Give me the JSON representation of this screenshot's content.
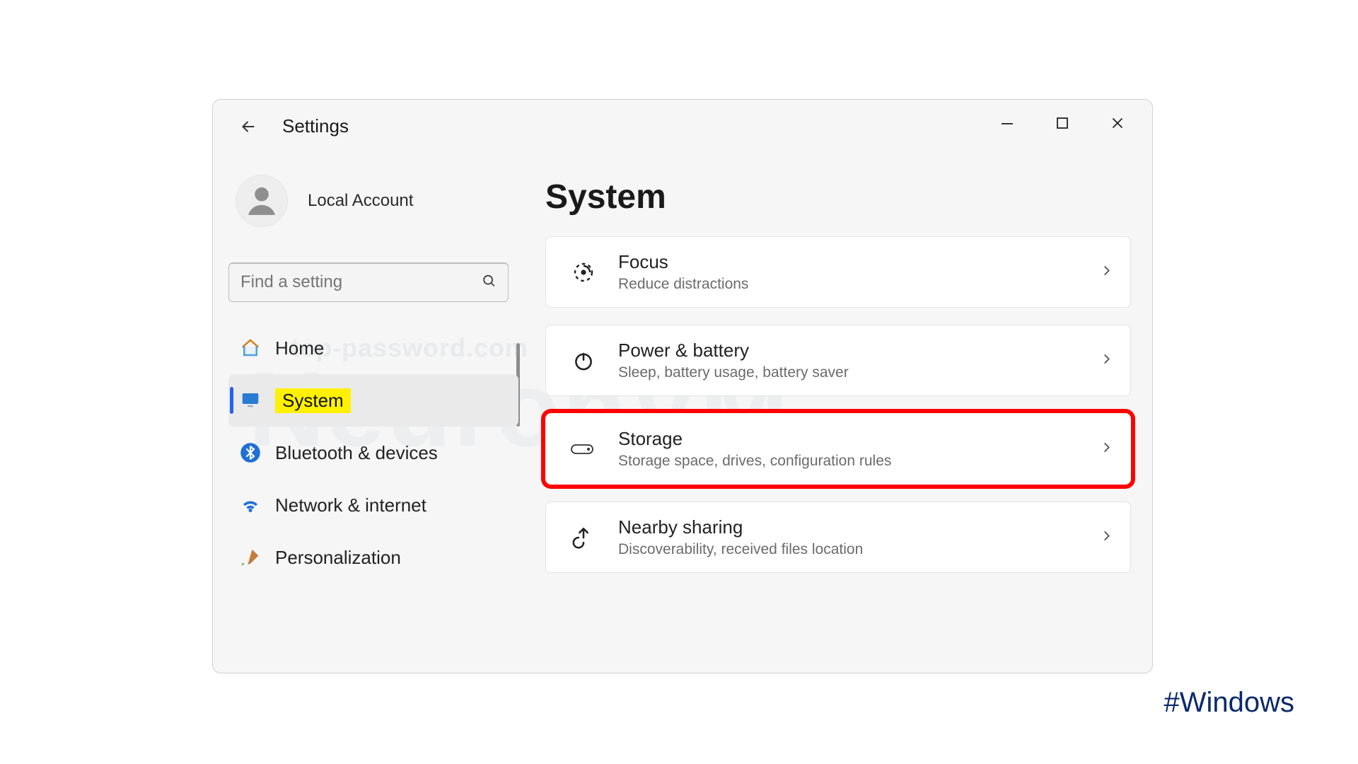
{
  "window": {
    "title": "Settings",
    "controls": {
      "minimize": "min",
      "maximize": "max",
      "close": "close"
    }
  },
  "account": {
    "name": "Local Account"
  },
  "search": {
    "placeholder": "Find a setting"
  },
  "sidebar": {
    "items": [
      {
        "id": "home",
        "label": "Home",
        "icon": "home-icon"
      },
      {
        "id": "system",
        "label": "System",
        "icon": "monitor-icon",
        "selected": true,
        "highlight": true
      },
      {
        "id": "bluetooth",
        "label": "Bluetooth & devices",
        "icon": "bluetooth-icon"
      },
      {
        "id": "network",
        "label": "Network & internet",
        "icon": "wifi-icon"
      },
      {
        "id": "personalization",
        "label": "Personalization",
        "icon": "brush-icon"
      }
    ]
  },
  "page": {
    "title": "System"
  },
  "cards": [
    {
      "id": "focus",
      "title": "Focus",
      "sub": "Reduce distractions",
      "icon": "focus-icon"
    },
    {
      "id": "power",
      "title": "Power & battery",
      "sub": "Sleep, battery usage, battery saver",
      "icon": "power-icon"
    },
    {
      "id": "storage",
      "title": "Storage",
      "sub": "Storage space, drives, configuration rules",
      "icon": "storage-icon",
      "outlined": true
    },
    {
      "id": "nearby",
      "title": "Nearby sharing",
      "sub": "Discoverability, received files location",
      "icon": "share-icon"
    }
  ],
  "watermark": {
    "line1": "top-password.com",
    "line2": "NeuronVM"
  },
  "hashtag": "#Windows",
  "colors": {
    "redOutline": "#ff0000",
    "highlightYellow": "#fff100",
    "accentBlue": "#2563eb"
  }
}
